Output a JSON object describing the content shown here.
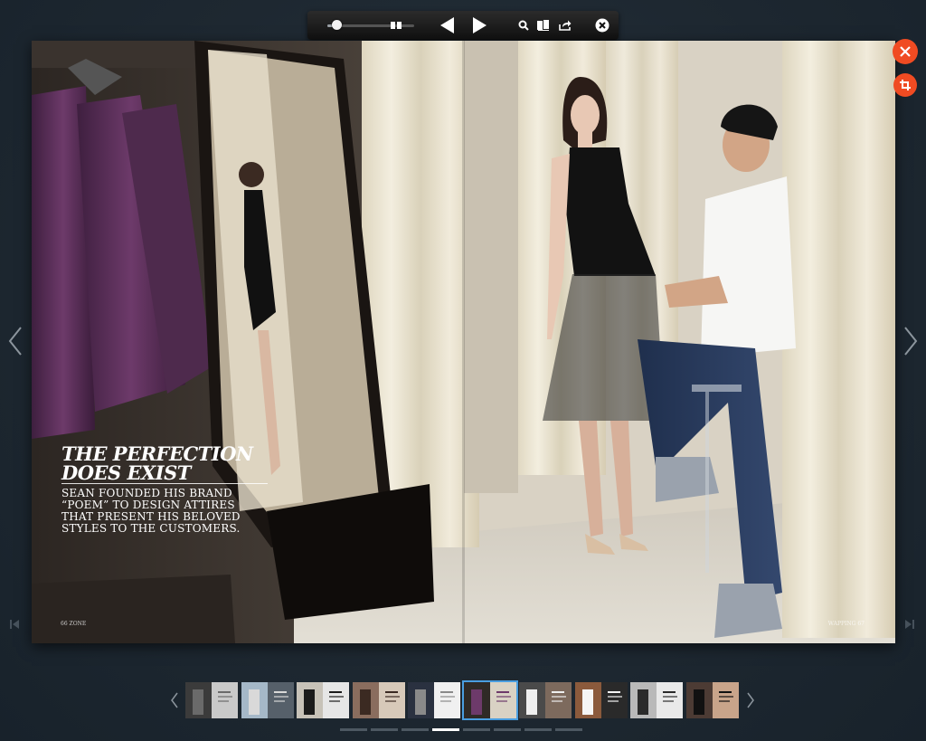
{
  "toolbar": {
    "zoom_level": 0.1,
    "icons": [
      "zoom-slider",
      "two-page-icon",
      "previous-page-icon",
      "next-page-icon",
      "search-icon",
      "thumbnails-icon",
      "share-icon",
      "exit-icon"
    ]
  },
  "article": {
    "headline_line1": "The Perfection",
    "headline_line2": "Does Exist",
    "subhead": "Sean founded his brand “Poem” to design attires that present his beloved styles to the customers.",
    "folio_left": "66 ZONE",
    "folio_right": "WAPPING 67"
  },
  "side_controls": {
    "close": "close-icon",
    "crop": "crop-icon",
    "prev": "chevron-left-icon",
    "next": "chevron-right-icon"
  },
  "thumbnails": {
    "count": 10,
    "active_index": 5
  },
  "pager": {
    "count": 8,
    "active_index": 3
  },
  "colors": {
    "accent": "#f04b22",
    "thumb_active": "#4a9ee0",
    "background": "#1f2a34"
  }
}
